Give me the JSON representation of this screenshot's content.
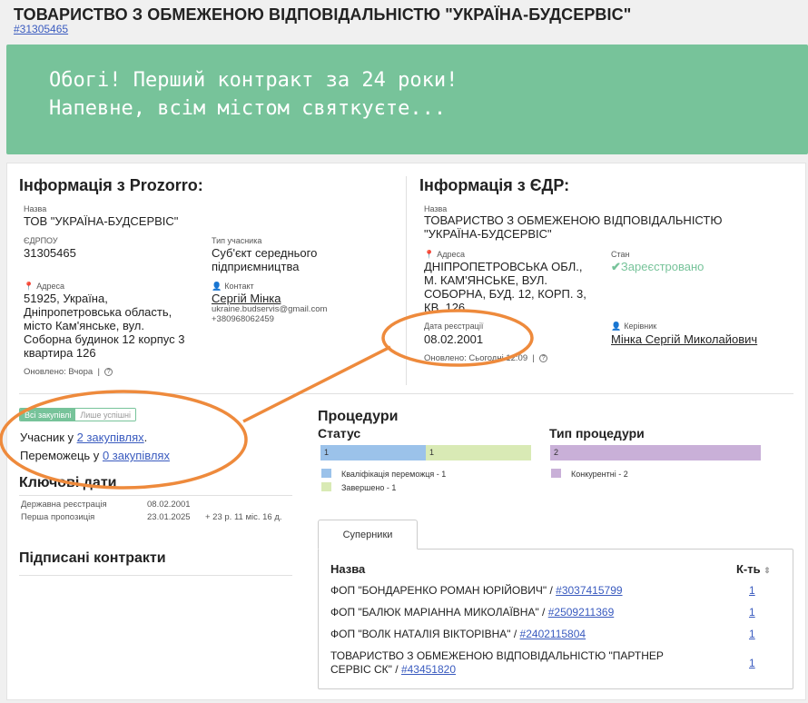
{
  "header": {
    "title": "ТОВАРИСТВО З ОБМЕЖЕНОЮ ВІДПОВІДАЛЬНІСТЮ \"УКРАЇНА-БУДСЕРВІС\"",
    "code_link": "#31305465"
  },
  "banner": {
    "line1": "Обогі! Перший контракт за 24 роки!",
    "line2": "Напевне, всім містом святкуєте..."
  },
  "prozorro": {
    "title": "Інформація з Prozorro:",
    "name_label": "Назва",
    "name": "ТОВ \"УКРАЇНА-БУДСЕРВІС\"",
    "edrpou_label": "ЄДРПОУ",
    "edrpou": "31305465",
    "type_label": "Тип учасника",
    "type_line1": "Суб'єкт середнього",
    "type_line2": "підприємництва",
    "address_label": "Адреса",
    "address_lines": [
      "51925, Україна,",
      "Дніпропетровська область,",
      "місто Кам'янське, вул.",
      "Соборна будинок 12 корпус 3",
      "квартира 126"
    ],
    "contact_label": "Контакт",
    "contact_name": "Сергій Мінка",
    "contact_email": "ukraine.budservis@gmail.com",
    "contact_phone": "+380968062459",
    "updated": "Оновлено: Вчора"
  },
  "edr": {
    "title": "Інформація з ЄДР:",
    "name_label": "Назва",
    "name_line1": "ТОВАРИСТВО З ОБМЕЖЕНОЮ ВІДПОВІДАЛЬНІСТЮ",
    "name_line2": "\"УКРАЇНА-БУДСЕРВІС\"",
    "address_label": "Адреса",
    "address_lines": [
      "ДНІПРОПЕТРОВСЬКА ОБЛ.,",
      "М. КАМ'ЯНСЬКЕ, ВУЛ.",
      "СОБОРНА, БУД. 12, КОРП. 3,",
      "КВ. 126"
    ],
    "status_label": "Стан",
    "status": "Зареєстровано",
    "reg_date_label": "Дата реєстрації",
    "reg_date": "08.02.2001",
    "head_label": "Керівник",
    "head": "Мінка Сергій Миколайович",
    "updated": "Оновлено: Сьогодні 12:09"
  },
  "toggle": {
    "all": "Всі закупівлі",
    "won": "Лише успішні"
  },
  "participation": {
    "participant_prefix": "Учасник у ",
    "participant_link": "2 закупівлях",
    "participant_suffix": ".",
    "winner_prefix": "Переможець у ",
    "winner_link": "0 закупівлях"
  },
  "key_dates": {
    "title": "Ключові дати",
    "rows": [
      {
        "label": "Державна реєстрація",
        "value": "08.02.2001",
        "extra": ""
      },
      {
        "label": "Перша пропозиція",
        "value": "23.01.2025",
        "extra": "+ 23 р. 11 міс. 16 д."
      }
    ]
  },
  "contracts": {
    "title": "Підписані контракти"
  },
  "procedures": {
    "title": "Процедури",
    "status_title": "Статус",
    "type_title": "Тип процедури",
    "status_legend": [
      "Кваліфікація переможця - 1",
      "Завершено - 1"
    ],
    "type_legend": [
      "Конкурентні - 2"
    ]
  },
  "colors": {
    "accent": "#77c39a",
    "bar_blue": "#9bc2ea",
    "bar_green": "#d9eab5",
    "bar_purple": "#c9b0d8",
    "annotation": "#ee8a3c"
  },
  "chart_data": [
    {
      "type": "bar",
      "title": "Статус",
      "stacked": true,
      "series": [
        {
          "name": "Кваліфікація переможця",
          "values": [
            1
          ]
        },
        {
          "name": "Завершено",
          "values": [
            1
          ]
        }
      ]
    },
    {
      "type": "bar",
      "title": "Тип процедури",
      "stacked": true,
      "series": [
        {
          "name": "Конкурентні",
          "values": [
            2
          ]
        }
      ]
    }
  ],
  "competitors": {
    "tab": "Суперники",
    "col_name": "Назва",
    "col_count": "К-ть",
    "rows": [
      {
        "name": "ФОП \"БОНДАРЕНКО РОМАН ЮРІЙОВИЧ\" / ",
        "code": "#3037415799",
        "count": "1"
      },
      {
        "name": "ФОП \"БАЛЮК МАРІАННА МИКОЛАЇВНА\" / ",
        "code": "#2509211369",
        "count": "1"
      },
      {
        "name": "ФОП \"ВОЛК НАТАЛІЯ ВІКТОРІВНА\" / ",
        "code": "#2402115804",
        "count": "1"
      },
      {
        "name_line1": "ТОВАРИСТВО З ОБМЕЖЕНОЮ ВІДПОВІДАЛЬНІСТЮ \"ПАРТНЕР",
        "name_line2": "СЕРВІС СК\" / ",
        "code": "#43451820",
        "count": "1"
      }
    ]
  }
}
